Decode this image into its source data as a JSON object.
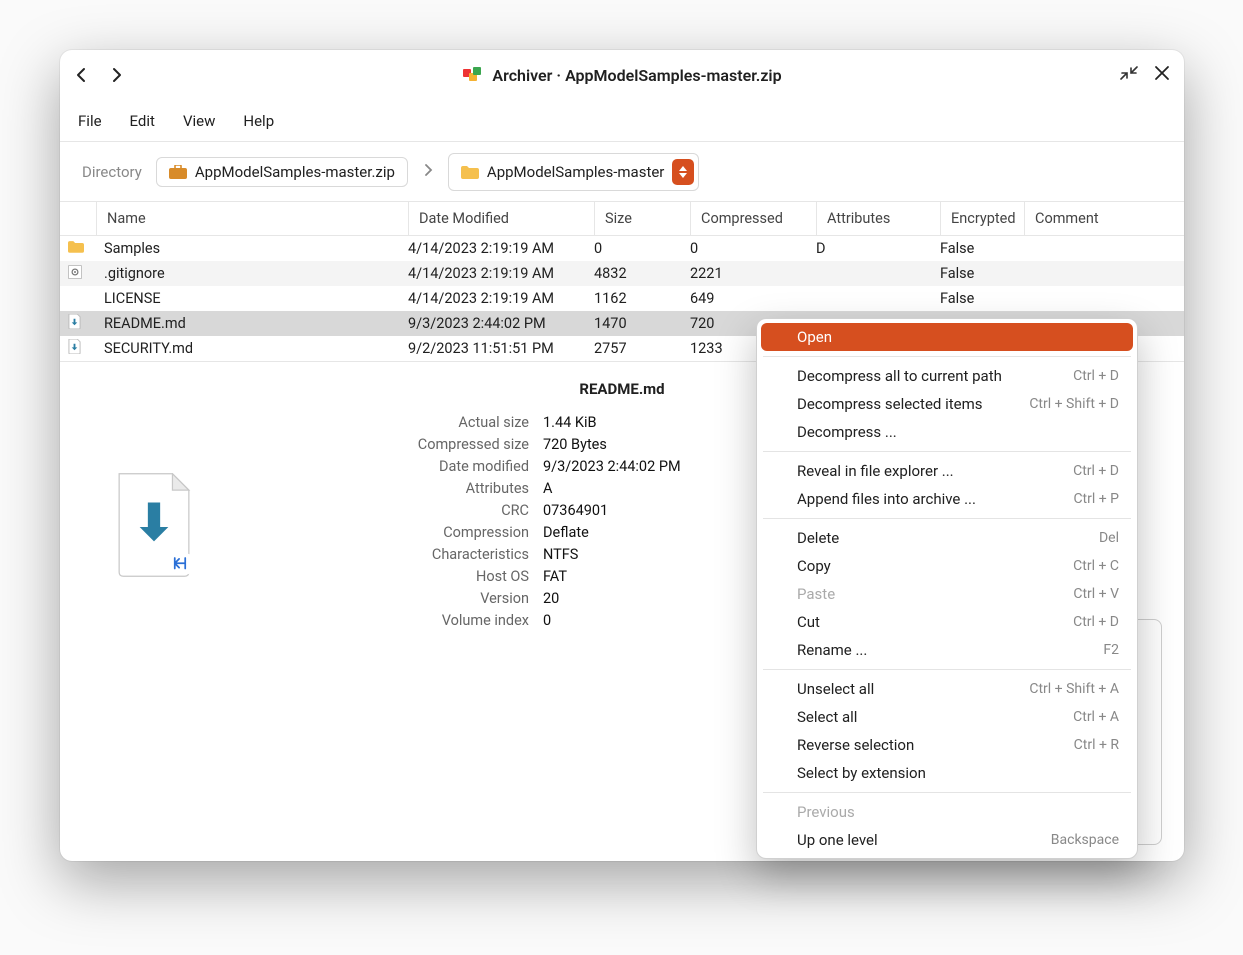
{
  "title": {
    "app": "Archiver",
    "sep": "·",
    "file": "AppModelSamples-master.zip"
  },
  "menubar": {
    "file": "File",
    "edit": "Edit",
    "view": "View",
    "help": "Help"
  },
  "pathbar": {
    "label": "Directory",
    "crumb1": "AppModelSamples-master.zip",
    "crumb2": "AppModelSamples-master"
  },
  "columns": {
    "name": "Name",
    "date": "Date Modified",
    "size": "Size",
    "compressed": "Compressed",
    "attributes": "Attributes",
    "encrypted": "Encrypted",
    "comment": "Comment"
  },
  "rows": [
    {
      "icon": "folder",
      "name": "Samples",
      "date": "4/14/2023 2:19:19 AM",
      "size": "0",
      "comp": "0",
      "attr": "D",
      "enc": "False"
    },
    {
      "icon": "gear",
      "name": ".gitignore",
      "date": "4/14/2023 2:19:19 AM",
      "size": "4832",
      "comp": "2221",
      "attr": "",
      "enc": "False"
    },
    {
      "icon": "blank",
      "name": "LICENSE",
      "date": "4/14/2023 2:19:19 AM",
      "size": "1162",
      "comp": "649",
      "attr": "",
      "enc": "False"
    },
    {
      "icon": "md",
      "name": "README.md",
      "date": "9/3/2023 2:44:02 PM",
      "size": "1470",
      "comp": "720",
      "attr": "",
      "enc": ""
    },
    {
      "icon": "md",
      "name": "SECURITY.md",
      "date": "9/2/2023 11:51:51 PM",
      "size": "2757",
      "comp": "1233",
      "attr": "",
      "enc": ""
    }
  ],
  "details": {
    "filename": "README.md",
    "kv": [
      {
        "k": "Actual size",
        "v": "1.44 KiB"
      },
      {
        "k": "Compressed size",
        "v": "720 Bytes"
      },
      {
        "k": "Date modified",
        "v": "9/3/2023 2:44:02 PM"
      },
      {
        "k": "Attributes",
        "v": "A"
      },
      {
        "k": "CRC",
        "v": "07364901"
      },
      {
        "k": "Compression",
        "v": "Deflate"
      },
      {
        "k": "Characteristics",
        "v": "NTFS"
      },
      {
        "k": "Host OS",
        "v": "FAT"
      },
      {
        "k": "Version",
        "v": "20"
      },
      {
        "k": "Volume index",
        "v": "0"
      }
    ]
  },
  "context": {
    "groups": [
      [
        {
          "label": "Open",
          "shortcut": "",
          "highlight": true
        }
      ],
      [
        {
          "label": "Decompress all to current path",
          "shortcut": "Ctrl + D"
        },
        {
          "label": "Decompress selected items",
          "shortcut": "Ctrl + Shift + D"
        },
        {
          "label": "Decompress ...",
          "shortcut": ""
        }
      ],
      [
        {
          "label": "Reveal in file explorer ...",
          "shortcut": "Ctrl + D"
        },
        {
          "label": "Append files into archive ...",
          "shortcut": "Ctrl + P"
        }
      ],
      [
        {
          "label": "Delete",
          "shortcut": "Del"
        },
        {
          "label": "Copy",
          "shortcut": "Ctrl + C"
        },
        {
          "label": "Paste",
          "shortcut": "Ctrl + V",
          "disabled": true
        },
        {
          "label": "Cut",
          "shortcut": "Ctrl + D"
        },
        {
          "label": "Rename ...",
          "shortcut": "F2"
        }
      ],
      [
        {
          "label": "Unselect all",
          "shortcut": "Ctrl + Shift + A"
        },
        {
          "label": "Select all",
          "shortcut": "Ctrl + A"
        },
        {
          "label": "Reverse selection",
          "shortcut": "Ctrl + R"
        },
        {
          "label": "Select by extension",
          "shortcut": ""
        }
      ],
      [
        {
          "label": "Previous",
          "shortcut": "",
          "disabled": true
        },
        {
          "label": "Up one level",
          "shortcut": "Backspace"
        }
      ]
    ]
  }
}
